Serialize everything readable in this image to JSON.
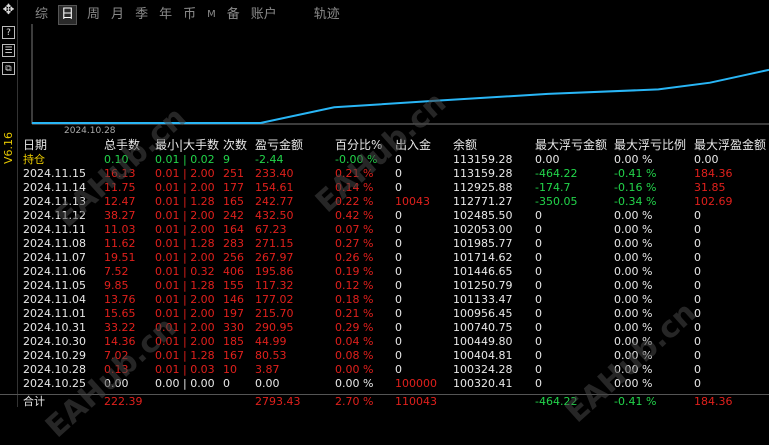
{
  "toolbar": {
    "tabs": [
      {
        "label": "综"
      },
      {
        "label": "日"
      },
      {
        "label": "周"
      },
      {
        "label": "月"
      },
      {
        "label": "季"
      },
      {
        "label": "年"
      },
      {
        "label": "币"
      },
      {
        "label": "M"
      },
      {
        "label": "备"
      },
      {
        "label": "账户"
      }
    ],
    "trace_label": "轨迹",
    "active_tab": "日"
  },
  "sidebar": {
    "move_icon": "four-way-arrow-icon",
    "help_label": "?",
    "version": "V6.16"
  },
  "chart": {
    "date_label": "2024.10.28",
    "line_color": "#29b6f6",
    "points": [
      [
        0,
        0
      ],
      [
        0.31,
        0
      ],
      [
        0.41,
        0.28
      ],
      [
        0.55,
        0.4
      ],
      [
        0.7,
        0.52
      ],
      [
        0.85,
        0.6
      ],
      [
        0.92,
        0.72
      ],
      [
        1.0,
        0.95
      ]
    ]
  },
  "table": {
    "headers": [
      "日期",
      "总手数",
      "最小|大手数",
      "次数",
      "盈亏金额",
      "百分比%",
      "出入金",
      "余额",
      "最大浮亏金额",
      "最大浮亏比例",
      "最大浮盈金额"
    ],
    "rows": [
      {
        "date": "持仓",
        "lots": "0.10",
        "minmax": "0.01 | 0.02",
        "count": "9",
        "pl": "-2.44",
        "pct": "-0.00 %",
        "flow": "0",
        "balance": "113159.28",
        "maxloss": "0.00",
        "maxlosspct": "0.00 %",
        "maxgain": "0.00",
        "color": "green",
        "date_color": "yellow",
        "loss_color": "white",
        "losspct_color": "white",
        "gain_color": "white",
        "flow_color": "white"
      },
      {
        "date": "2024.11.15",
        "lots": "16.13",
        "minmax": "0.01 | 2.00",
        "count": "251",
        "pl": "233.40",
        "pct": "0.21 %",
        "flow": "0",
        "balance": "113159.28",
        "maxloss": "-464.22",
        "maxlosspct": "-0.41 %",
        "maxgain": "184.36",
        "color": "red",
        "date_color": "white",
        "loss_color": "green",
        "losspct_color": "green",
        "gain_color": "red",
        "flow_color": "white"
      },
      {
        "date": "2024.11.14",
        "lots": "11.75",
        "minmax": "0.01 | 2.00",
        "count": "177",
        "pl": "154.61",
        "pct": "0.14 %",
        "flow": "0",
        "balance": "112925.88",
        "maxloss": "-174.7",
        "maxlosspct": "-0.16 %",
        "maxgain": "31.85",
        "color": "red",
        "date_color": "white",
        "loss_color": "green",
        "losspct_color": "green",
        "gain_color": "red",
        "flow_color": "white"
      },
      {
        "date": "2024.11.13",
        "lots": "12.47",
        "minmax": "0.01 | 1.28",
        "count": "165",
        "pl": "242.77",
        "pct": "0.22 %",
        "flow": "10043",
        "balance": "112771.27",
        "maxloss": "-350.05",
        "maxlosspct": "-0.34 %",
        "maxgain": "102.69",
        "color": "red",
        "date_color": "white",
        "loss_color": "green",
        "losspct_color": "green",
        "gain_color": "red",
        "flow_color": "red"
      },
      {
        "date": "2024.11.12",
        "lots": "38.27",
        "minmax": "0.01 | 2.00",
        "count": "242",
        "pl": "432.50",
        "pct": "0.42 %",
        "flow": "0",
        "balance": "102485.50",
        "maxloss": "0",
        "maxlosspct": "0.00 %",
        "maxgain": "0",
        "color": "red",
        "date_color": "white",
        "loss_color": "white",
        "losspct_color": "white",
        "gain_color": "white",
        "flow_color": "white"
      },
      {
        "date": "2024.11.11",
        "lots": "11.03",
        "minmax": "0.01 | 2.00",
        "count": "164",
        "pl": "67.23",
        "pct": "0.07 %",
        "flow": "0",
        "balance": "102053.00",
        "maxloss": "0",
        "maxlosspct": "0.00 %",
        "maxgain": "0",
        "color": "red",
        "date_color": "white",
        "loss_color": "white",
        "losspct_color": "white",
        "gain_color": "white",
        "flow_color": "white"
      },
      {
        "date": "2024.11.08",
        "lots": "11.62",
        "minmax": "0.01 | 1.28",
        "count": "283",
        "pl": "271.15",
        "pct": "0.27 %",
        "flow": "0",
        "balance": "101985.77",
        "maxloss": "0",
        "maxlosspct": "0.00 %",
        "maxgain": "0",
        "color": "red",
        "date_color": "white",
        "loss_color": "white",
        "losspct_color": "white",
        "gain_color": "white",
        "flow_color": "white"
      },
      {
        "date": "2024.11.07",
        "lots": "19.51",
        "minmax": "0.01 | 2.00",
        "count": "256",
        "pl": "267.97",
        "pct": "0.26 %",
        "flow": "0",
        "balance": "101714.62",
        "maxloss": "0",
        "maxlosspct": "0.00 %",
        "maxgain": "0",
        "color": "red",
        "date_color": "white",
        "loss_color": "white",
        "losspct_color": "white",
        "gain_color": "white",
        "flow_color": "white"
      },
      {
        "date": "2024.11.06",
        "lots": "7.52",
        "minmax": "0.01 | 0.32",
        "count": "406",
        "pl": "195.86",
        "pct": "0.19 %",
        "flow": "0",
        "balance": "101446.65",
        "maxloss": "0",
        "maxlosspct": "0.00 %",
        "maxgain": "0",
        "color": "red",
        "date_color": "white",
        "loss_color": "white",
        "losspct_color": "white",
        "gain_color": "white",
        "flow_color": "white"
      },
      {
        "date": "2024.11.05",
        "lots": "9.85",
        "minmax": "0.01 | 1.28",
        "count": "155",
        "pl": "117.32",
        "pct": "0.12 %",
        "flow": "0",
        "balance": "101250.79",
        "maxloss": "0",
        "maxlosspct": "0.00 %",
        "maxgain": "0",
        "color": "red",
        "date_color": "white",
        "loss_color": "white",
        "losspct_color": "white",
        "gain_color": "white",
        "flow_color": "white"
      },
      {
        "date": "2024.11.04",
        "lots": "13.76",
        "minmax": "0.01 | 2.00",
        "count": "146",
        "pl": "177.02",
        "pct": "0.18 %",
        "flow": "0",
        "balance": "101133.47",
        "maxloss": "0",
        "maxlosspct": "0.00 %",
        "maxgain": "0",
        "color": "red",
        "date_color": "white",
        "loss_color": "white",
        "losspct_color": "white",
        "gain_color": "white",
        "flow_color": "white"
      },
      {
        "date": "2024.11.01",
        "lots": "15.65",
        "minmax": "0.01 | 2.00",
        "count": "197",
        "pl": "215.70",
        "pct": "0.21 %",
        "flow": "0",
        "balance": "100956.45",
        "maxloss": "0",
        "maxlosspct": "0.00 %",
        "maxgain": "0",
        "color": "red",
        "date_color": "white",
        "loss_color": "white",
        "losspct_color": "white",
        "gain_color": "white",
        "flow_color": "white"
      },
      {
        "date": "2024.10.31",
        "lots": "33.22",
        "minmax": "0.01 | 2.00",
        "count": "330",
        "pl": "290.95",
        "pct": "0.29 %",
        "flow": "0",
        "balance": "100740.75",
        "maxloss": "0",
        "maxlosspct": "0.00 %",
        "maxgain": "0",
        "color": "red",
        "date_color": "white",
        "loss_color": "white",
        "losspct_color": "white",
        "gain_color": "white",
        "flow_color": "white"
      },
      {
        "date": "2024.10.30",
        "lots": "14.36",
        "minmax": "0.01 | 2.00",
        "count": "185",
        "pl": "44.99",
        "pct": "0.04 %",
        "flow": "0",
        "balance": "100449.80",
        "maxloss": "0",
        "maxlosspct": "0.00 %",
        "maxgain": "0",
        "color": "red",
        "date_color": "white",
        "loss_color": "white",
        "losspct_color": "white",
        "gain_color": "white",
        "flow_color": "white"
      },
      {
        "date": "2024.10.29",
        "lots": "7.02",
        "minmax": "0.01 | 1.28",
        "count": "167",
        "pl": "80.53",
        "pct": "0.08 %",
        "flow": "0",
        "balance": "100404.81",
        "maxloss": "0",
        "maxlosspct": "0.00 %",
        "maxgain": "0",
        "color": "red",
        "date_color": "white",
        "loss_color": "white",
        "losspct_color": "white",
        "gain_color": "white",
        "flow_color": "white"
      },
      {
        "date": "2024.10.28",
        "lots": "0.13",
        "minmax": "0.01 | 0.03",
        "count": "10",
        "pl": "3.87",
        "pct": "0.00 %",
        "flow": "0",
        "balance": "100324.28",
        "maxloss": "0",
        "maxlosspct": "0.00 %",
        "maxgain": "0",
        "color": "red",
        "date_color": "white",
        "loss_color": "white",
        "losspct_color": "white",
        "gain_color": "white",
        "flow_color": "white"
      },
      {
        "date": "2024.10.25",
        "lots": "0.00",
        "minmax": "0.00 | 0.00",
        "count": "0",
        "pl": "0.00",
        "pct": "0.00 %",
        "flow": "100000",
        "balance": "100320.41",
        "maxloss": "0",
        "maxlosspct": "0.00 %",
        "maxgain": "0",
        "color": "white",
        "date_color": "white",
        "loss_color": "white",
        "losspct_color": "white",
        "gain_color": "white",
        "flow_color": "red"
      }
    ],
    "footer": {
      "date": "合计",
      "lots": "222.39",
      "pl": "2793.43",
      "pct": "2.70 %",
      "flow": "110043",
      "maxloss": "-464.22",
      "maxlosspct": "-0.41 %",
      "maxgain": "184.36"
    }
  },
  "watermark": "EAHub.cn"
}
